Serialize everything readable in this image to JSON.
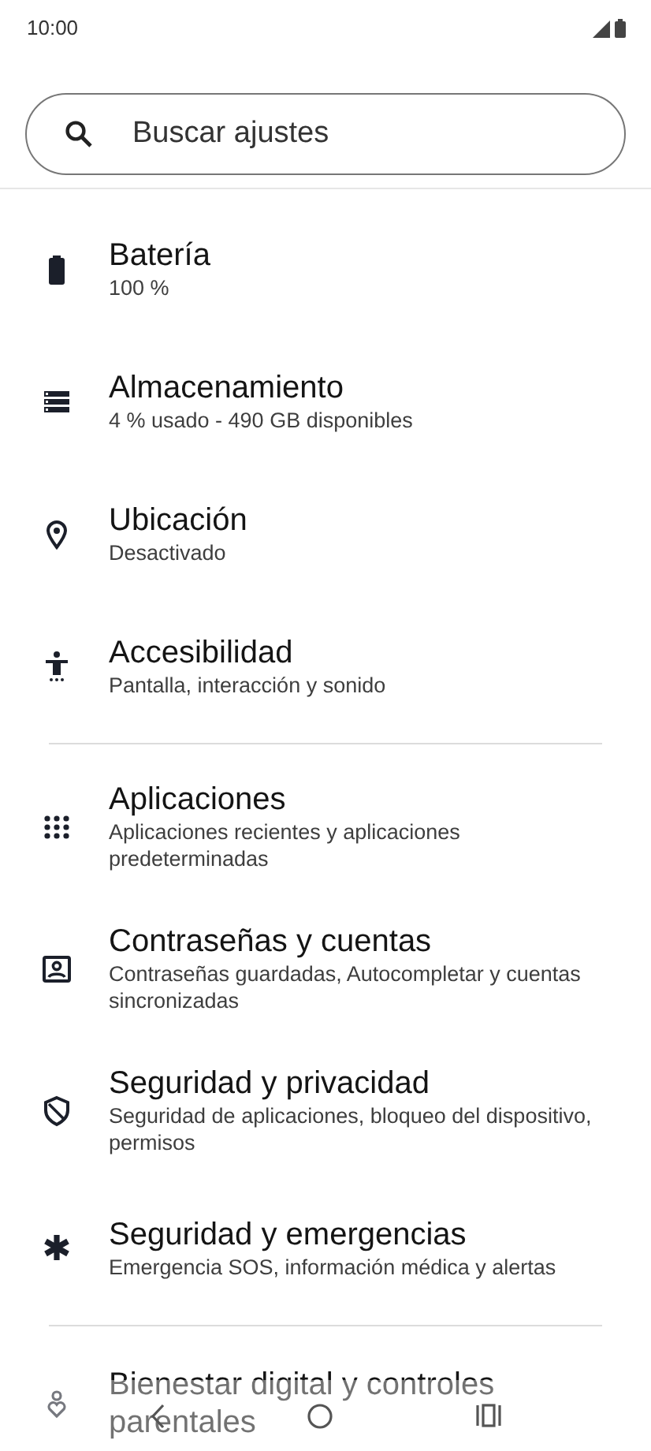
{
  "status_bar": {
    "time": "10:00"
  },
  "search": {
    "placeholder": "Buscar ajustes"
  },
  "sections": [
    {
      "items": [
        {
          "title": "Batería",
          "subtitle": "100 %"
        },
        {
          "title": "Almacenamiento",
          "subtitle": "4 % usado - 490 GB disponibles"
        },
        {
          "title": "Ubicación",
          "subtitle": "Desactivado"
        },
        {
          "title": "Accesibilidad",
          "subtitle": "Pantalla, interacción y sonido"
        }
      ]
    },
    {
      "items": [
        {
          "title": "Aplicaciones",
          "subtitle": "Aplicaciones recientes y aplicaciones predeterminadas"
        },
        {
          "title": "Contraseñas y cuentas",
          "subtitle": "Contraseñas guardadas, Autocompletar y cuentas sincronizadas"
        },
        {
          "title": "Seguridad y privacidad",
          "subtitle": "Seguridad de aplicaciones, bloqueo del dispositivo, permisos"
        },
        {
          "title": "Seguridad y emergencias",
          "subtitle": "Emergencia SOS, información médica y alertas"
        }
      ]
    },
    {
      "items": [
        {
          "title": "Bienestar digital y controles parentales"
        }
      ]
    }
  ]
}
